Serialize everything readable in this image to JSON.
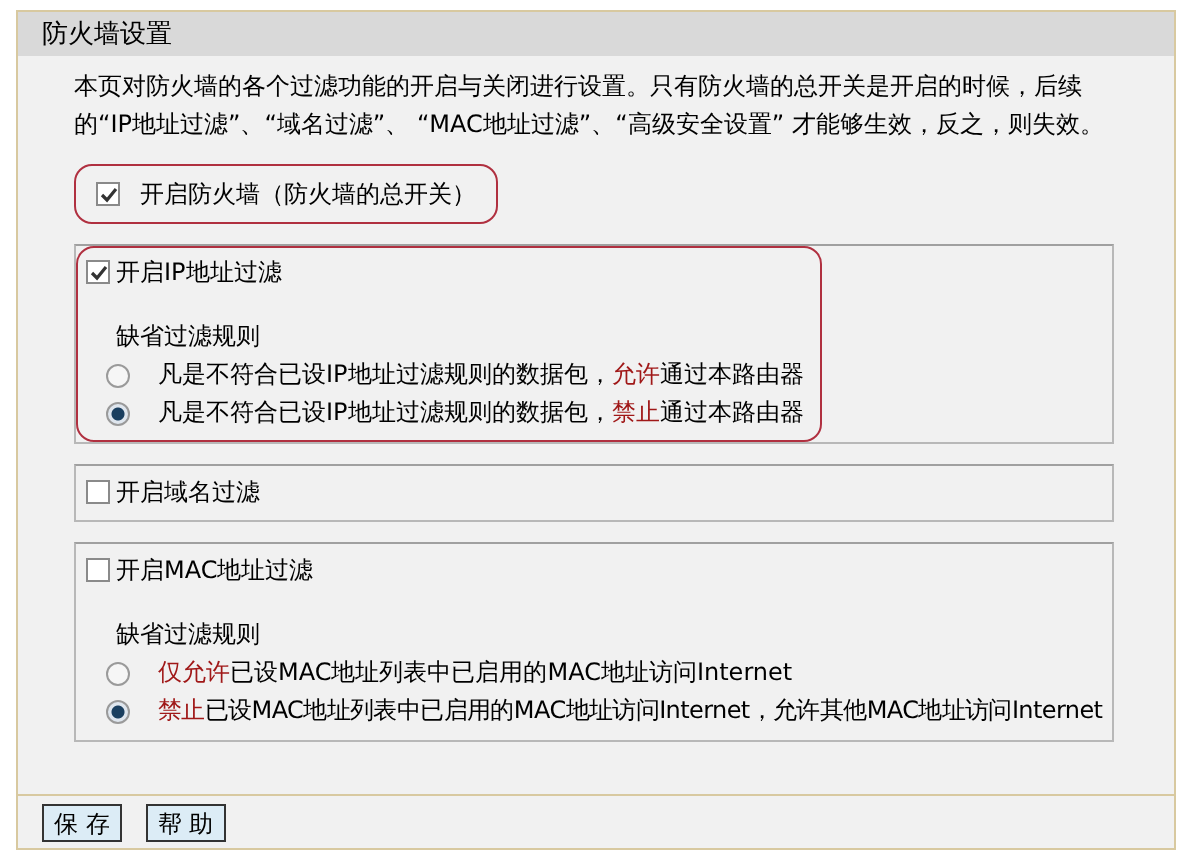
{
  "title": "防火墙设置",
  "description": "本页对防火墙的各个过滤功能的开启与关闭进行设置。只有防火墙的总开关是开启的时候，后续的“IP地址过滤”、“域名过滤”、 “MAC地址过滤”、“高级安全设置” 才能够生效，反之，则失效。",
  "master_switch": {
    "label": "开启防火墙（防火墙的总开关）",
    "checked": true,
    "highlighted": true
  },
  "sections": [
    {
      "label": "开启IP地址过滤",
      "checked": true,
      "highlighted": true,
      "rule_title": "缺省过滤规则",
      "options": [
        {
          "before": "凡是不符合已设IP地址过滤规则的数据包，",
          "emphasis": "允许",
          "after": "通过本路由器",
          "selected": false
        },
        {
          "before": "凡是不符合已设IP地址过滤规则的数据包，",
          "emphasis": "禁止",
          "after": "通过本路由器",
          "selected": true
        }
      ]
    },
    {
      "label": "开启域名过滤",
      "checked": false,
      "highlighted": false
    },
    {
      "label": "开启MAC地址过滤",
      "checked": false,
      "highlighted": false,
      "rule_title": "缺省过滤规则",
      "options": [
        {
          "emphasis": "仅允许",
          "after": "已设MAC地址列表中已启用的MAC地址访问Internet",
          "selected": false
        },
        {
          "emphasis": "禁止",
          "after": "已设MAC地址列表中已启用的MAC地址访问Internet，允许其他MAC地址访问Internet",
          "selected": true
        }
      ]
    }
  ],
  "buttons": [
    "保 存",
    "帮 助"
  ]
}
